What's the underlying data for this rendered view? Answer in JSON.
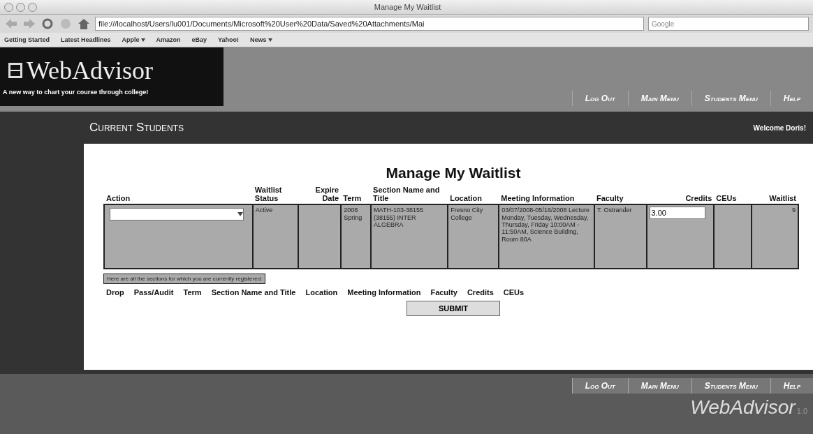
{
  "browser": {
    "title": "Manage My Waitlist",
    "url": "file:///localhost/Users/lu001/Documents/Microsoft%20User%20Data/Saved%20Attachments/Mai",
    "search_placeholder": "Google",
    "bookmarks": [
      {
        "label": "Getting Started",
        "menu": false
      },
      {
        "label": "Latest Headlines",
        "menu": false
      },
      {
        "label": "Apple",
        "menu": true
      },
      {
        "label": "Amazon",
        "menu": false
      },
      {
        "label": "eBay",
        "menu": false
      },
      {
        "label": "Yahoo!",
        "menu": false
      },
      {
        "label": "News",
        "menu": true
      }
    ]
  },
  "header": {
    "logo_text": "WebAdvisor",
    "tagline": "A new way to chart your course through college!",
    "nav": [
      "Log Out",
      "Main Menu",
      "Students Menu",
      "Help"
    ]
  },
  "subheader": {
    "section": "Current Students",
    "welcome": "Welcome Doris!"
  },
  "page": {
    "heading": "Manage My Waitlist",
    "columns": [
      "Action",
      "Waitlist Status",
      "Expire Date",
      "Term",
      "Section Name and Title",
      "Location",
      "Meeting Information",
      "Faculty",
      "Credits",
      "CEUs",
      "Waitlist"
    ],
    "rows": [
      {
        "cells": [
          {
            "kind": "select"
          },
          {
            "kind": "text",
            "value": "Active"
          },
          {
            "kind": "blank"
          },
          {
            "kind": "text",
            "value": "2008 Spring"
          },
          {
            "kind": "text",
            "value": "MATH-103-38155 (38155) INTER ALGEBRA"
          },
          {
            "kind": "text",
            "value": "Fresno City College"
          },
          {
            "kind": "text",
            "value": "03/07/2008-05/16/2008 Lecture Monday, Tuesday, Wednesday, Thursday, Friday 10:00AM - 11:50AM, Science Building, Room 80A"
          },
          {
            "kind": "text",
            "value": "T. Ostrander"
          },
          {
            "kind": "input",
            "value": "3.00"
          },
          {
            "kind": "blank"
          },
          {
            "kind": "number",
            "value": "9"
          }
        ]
      }
    ],
    "note": "Here are all the sections for which you are currently registered:",
    "registered_columns": [
      "Drop",
      "Pass/Audit",
      "Term",
      "Section Name and Title",
      "Location",
      "Meeting Information",
      "Faculty",
      "Credits",
      "CEUs"
    ],
    "submit": "SUBMIT"
  },
  "footer": {
    "nav": [
      "Log Out",
      "Main Menu",
      "Students Menu",
      "Help"
    ],
    "logo_text": "WebAdvisor",
    "version": "1.0"
  }
}
